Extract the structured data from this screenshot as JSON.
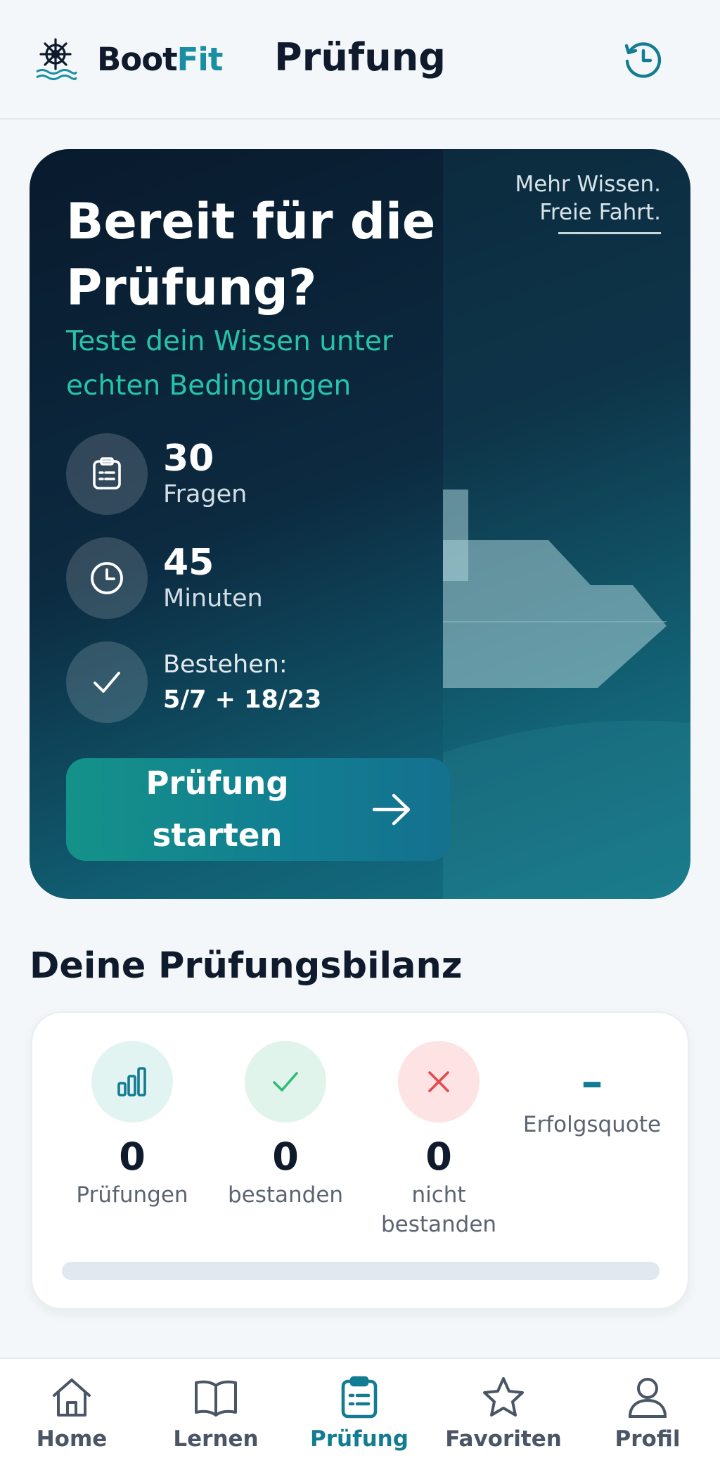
{
  "header": {
    "brand_part1": "Boot",
    "brand_part2": "Fit",
    "title": "Prüfung",
    "history_icon": "history-icon"
  },
  "hero": {
    "slogan_line1": "Mehr Wissen.",
    "slogan_line2": "Freie Fahrt.",
    "title": "Bereit für die Prüfung?",
    "subtitle": "Teste dein Wissen unter echten Bedingungen",
    "questions": {
      "value": "30",
      "label": "Fragen",
      "icon": "clipboard-icon"
    },
    "duration": {
      "value": "45",
      "label": "Minuten",
      "icon": "clock-icon"
    },
    "pass": {
      "label": "Bestehen:",
      "value": "5/7 + 18/23",
      "icon": "check-icon"
    },
    "start_button": "Prüfung starten"
  },
  "stats": {
    "section_title": "Deine Prüfungsbilanz",
    "exams": {
      "value": "0",
      "label": "Prüfungen",
      "icon": "bar-chart-icon"
    },
    "passed": {
      "value": "0",
      "label": "bestanden",
      "icon": "check-icon"
    },
    "failed": {
      "value": "0",
      "label": "nicht bestanden",
      "icon": "x-icon"
    },
    "success_rate": {
      "value": "–",
      "label": "Erfolgsquote"
    },
    "progress_fraction": 0
  },
  "nav": {
    "items": [
      {
        "label": "Home",
        "icon": "home-icon"
      },
      {
        "label": "Lernen",
        "icon": "book-icon"
      },
      {
        "label": "Prüfung",
        "icon": "clipboard-icon",
        "active": true
      },
      {
        "label": "Favoriten",
        "icon": "star-icon"
      },
      {
        "label": "Profil",
        "icon": "user-icon"
      }
    ]
  },
  "colors": {
    "accent": "#137c92",
    "brand_teal": "#1a8fa3",
    "subtitle_green": "#27c3a8",
    "passed_green": "#2ebd77",
    "failed_red": "#e5484d"
  }
}
